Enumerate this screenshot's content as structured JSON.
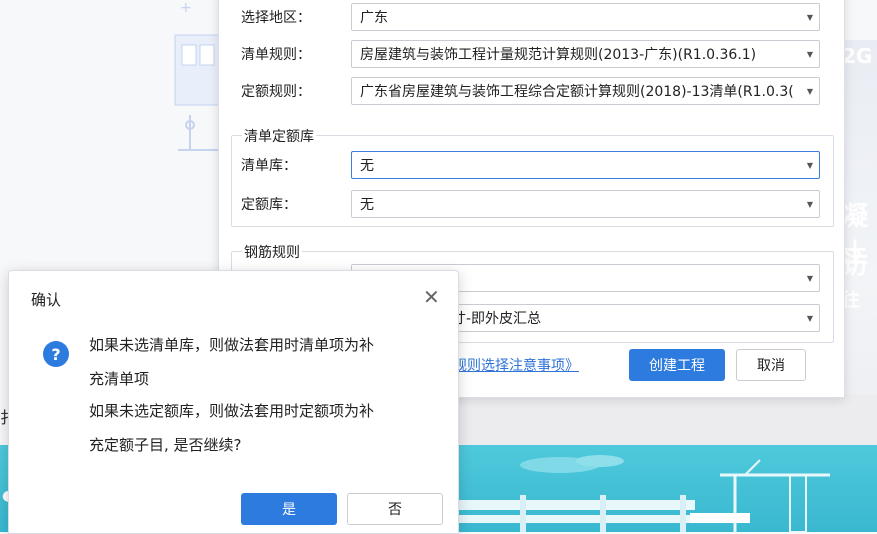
{
  "form": {
    "region_label": "选择地区：",
    "region_value": "广东",
    "list_rule_label": "清单规则：",
    "list_rule_value": "房屋建筑与装饰工程计量规范计算规则(2013-广东)(R1.0.36.1)",
    "quota_rule_label": "定额规则：",
    "quota_rule_value": "广东省房屋建筑与装饰工程综合定额计算规则(2018)-13清单(R1.0.3("
  },
  "library_group": {
    "title": "清单定额库",
    "list_lib_label": "清单库：",
    "list_lib_value": "无",
    "quota_lib_label": "定额库：",
    "quota_lib_value": "无"
  },
  "rebar_group": {
    "title": "钢筋规则",
    "rule2_value": "寸-即外皮汇总"
  },
  "footer": {
    "link_text": "规则选择注意事项》",
    "create_label": "创建工程",
    "cancel_label": "取消"
  },
  "confirm": {
    "title": "确认",
    "close_glyph": "✕",
    "icon_glyph": "?",
    "line1": "如果未选清单库，则做法套用时清单项为补",
    "line2": "充清单项",
    "line3": "如果未选定额库，则做法套用时定额项为补",
    "line4": "充定额子目, 是否继续?",
    "yes_label": "是",
    "no_label": "否"
  },
  "background": {
    "right_text_1": "2G",
    "right_text_2": "凝土",
    "right_text_3": "访",
    "right_text_4": "往",
    "left_char": "扌"
  },
  "colors": {
    "accent": "#2e7be0",
    "teal": "#39b8d0"
  },
  "icons": {
    "caret": "dropdown-caret-icon",
    "question": "question-icon",
    "close": "close-icon"
  }
}
